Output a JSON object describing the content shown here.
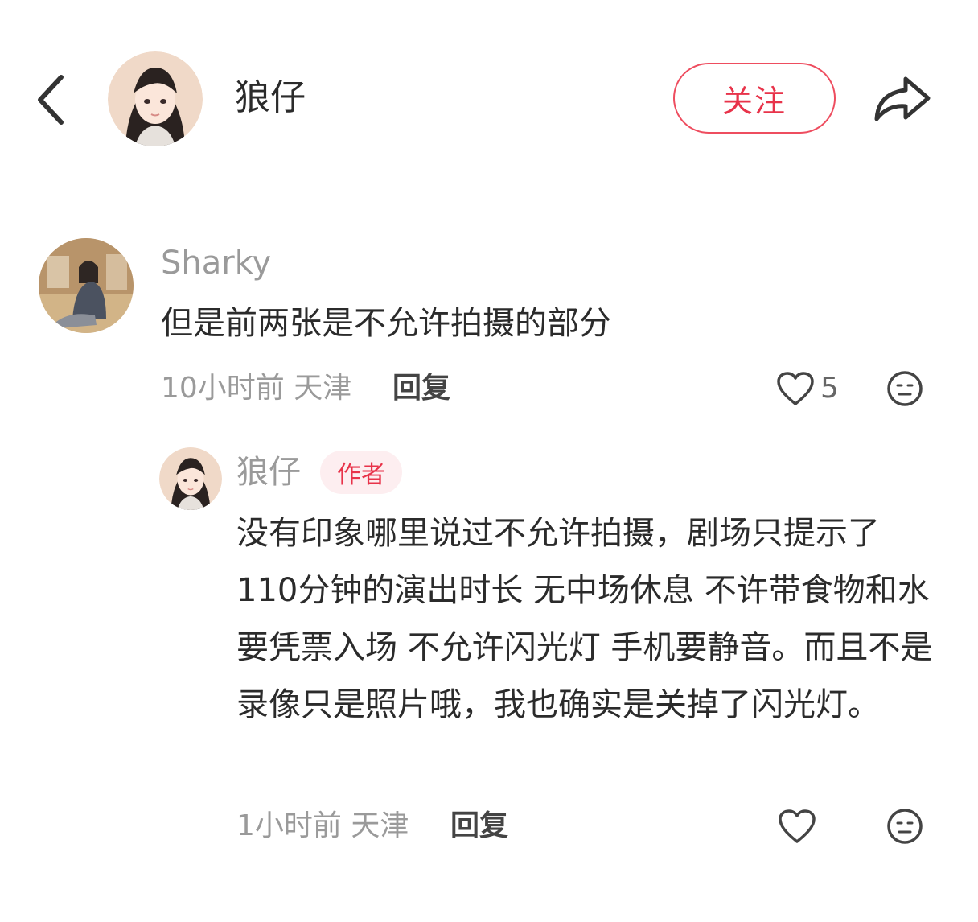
{
  "header": {
    "back_icon": "chevron-left-icon",
    "avatar_icon": "user-avatar",
    "username": "狼仔",
    "follow_label": "关注",
    "share_icon": "share-icon"
  },
  "comments": [
    {
      "avatar_icon": "user-avatar",
      "username": "Sharky",
      "text": "但是前两张是不允许拍摄的部分",
      "time": "10小时前",
      "location": "天津",
      "reply_label": "回复",
      "like_icon": "heart-icon",
      "like_count": "5",
      "emoji_icon": "emoji-icon",
      "replies": [
        {
          "avatar_icon": "user-avatar",
          "username": "狼仔",
          "badge": "作者",
          "text": "没有印象哪里说过不允许拍摄，剧场只提示了110分钟的演出时长 无中场休息 不许带食物和水 要凭票入场 不允许闪光灯 手机要静音。而且不是录像只是照片哦，我也确实是关掉了闪光灯。",
          "time": "1小时前",
          "location": "天津",
          "reply_label": "回复",
          "like_icon": "heart-icon",
          "emoji_icon": "emoji-icon"
        }
      ]
    }
  ],
  "colors": {
    "accent": "#e8334a",
    "badge_bg": "#fdeef0",
    "meta_text": "#9a9a9a",
    "body_text": "#2b2b2b"
  }
}
